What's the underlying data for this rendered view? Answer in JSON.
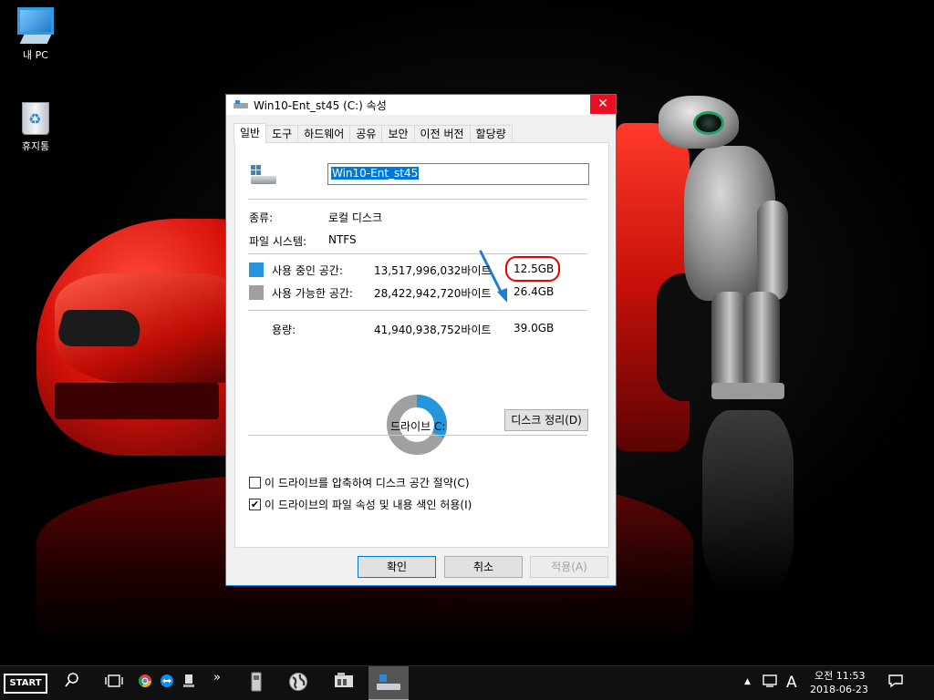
{
  "desktop": {
    "icons": [
      {
        "label": "내 PC"
      },
      {
        "label": "휴지통"
      }
    ]
  },
  "window": {
    "title": "Win10-Ent_st45 (C:) 속성",
    "close_glyph": "✕",
    "tabs": [
      "일반",
      "도구",
      "하드웨어",
      "공유",
      "보안",
      "이전 버전",
      "할당량"
    ],
    "active_tab": "일반",
    "drive_name": "Win10-Ent_st45",
    "type_label": "종류:",
    "type_value": "로컬 디스크",
    "fs_label": "파일 시스템:",
    "fs_value": "NTFS",
    "used": {
      "label": "사용 중인 공간:",
      "bytes": "13,517,996,032바이트",
      "size": "12.5GB",
      "color": "#2596db"
    },
    "free": {
      "label": "사용 가능한 공간:",
      "bytes": "28,422,942,720바이트",
      "size": "26.4GB",
      "color": "#a0a0a0"
    },
    "capacity": {
      "label": "용량:",
      "bytes": "41,940,938,752바이트",
      "size": "39.0GB"
    },
    "used_fraction": 0.322,
    "drive_caption": "드라이브 C:",
    "cleanup_button": "디스크 정리(D)",
    "checkbox_compress": {
      "label": "이 드라이브를 압축하여 디스크 공간 절약(C)",
      "checked": false
    },
    "checkbox_index": {
      "label": "이 드라이브의 파일 속성 및 내용 색인 허용(I)",
      "checked": true
    },
    "ok_button": "확인",
    "cancel_button": "취소",
    "apply_button": "적용(A)",
    "annotation_color": "#e00000",
    "arrow_color": "#1a7fd4"
  },
  "taskbar": {
    "start_label": "START",
    "overflow_glyph": "»",
    "tray": {
      "up_glyph": "▲",
      "ime": "A",
      "time": "오전 11:53",
      "date": "2018-06-23"
    }
  }
}
